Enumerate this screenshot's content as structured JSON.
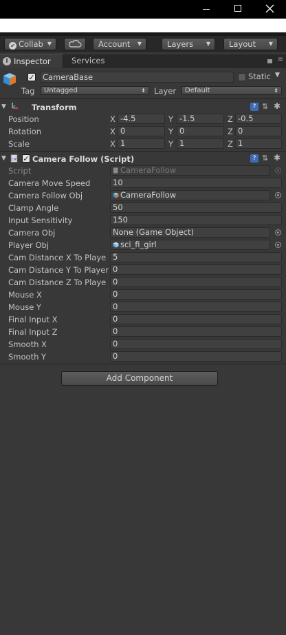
{
  "window": {
    "minimize_glyph": "",
    "maximize_glyph": "",
    "close_glyph": ""
  },
  "toolbar": {
    "collab_label": "Collab",
    "account_label": "Account",
    "layers_label": "Layers",
    "layout_label": "Layout",
    "cloud_icon": "cloud-icon"
  },
  "tabs": {
    "inspector_label": "Inspector",
    "services_label": "Services"
  },
  "gameobject": {
    "name": "CameraBase",
    "static_label": "Static",
    "tag_label": "Tag",
    "tag_value": "Untagged",
    "layer_label": "Layer",
    "layer_value": "Default"
  },
  "transform": {
    "title": "Transform",
    "rows": [
      {
        "label": "Position",
        "x": "-4.5",
        "y": "-1.5",
        "z": "-0.5"
      },
      {
        "label": "Rotation",
        "x": "0",
        "y": "0",
        "z": "0"
      },
      {
        "label": "Scale",
        "x": "1",
        "y": "1",
        "z": "1"
      }
    ],
    "axis_x": "X",
    "axis_y": "Y",
    "axis_z": "Z"
  },
  "script_component": {
    "title": "Camera Follow (Script)",
    "script_label": "Script",
    "script_value": "CameraFollow",
    "fields": [
      {
        "label": "Camera Move Speed",
        "value": "10"
      },
      {
        "label": "Camera Follow Obj",
        "value": "CameraFollow"
      },
      {
        "label": "Clamp Angle",
        "value": "50"
      },
      {
        "label": "Input Sensitivity",
        "value": "150"
      },
      {
        "label": "Camera Obj",
        "value": "None (Game Object)"
      },
      {
        "label": "Player Obj",
        "value": "sci_fi_girl"
      },
      {
        "label": "Cam Distance X To Playe",
        "value": "5"
      },
      {
        "label": "Cam Distance Y To Player",
        "value": "0"
      },
      {
        "label": "Cam Distance Z To Playe",
        "value": "0"
      },
      {
        "label": "Mouse X",
        "value": "0"
      },
      {
        "label": "Mouse Y",
        "value": "0"
      },
      {
        "label": "Final Input X",
        "value": "0"
      },
      {
        "label": "Final Input Z",
        "value": "0"
      },
      {
        "label": "Smooth X",
        "value": "0"
      },
      {
        "label": "Smooth Y",
        "value": "0"
      }
    ]
  },
  "add_component_label": "Add Component",
  "colors": {
    "panel": "#383838",
    "toolbar": "#282828",
    "field": "#404040",
    "accent_help": "#3f6bb3"
  }
}
